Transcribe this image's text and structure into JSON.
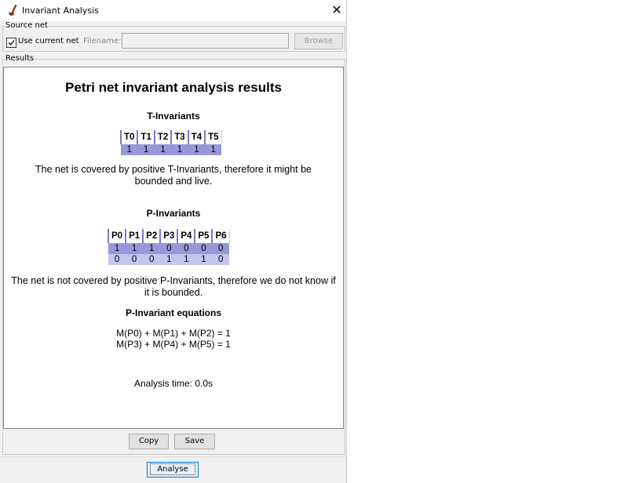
{
  "window": {
    "title": "Invariant Analysis",
    "close_glyph": "✕"
  },
  "source": {
    "legend": "Source net",
    "use_current_label": "Use current net",
    "use_current_checked": true,
    "filename_label": "Filename:",
    "filename_value": "",
    "browse_label": "Browse"
  },
  "results": {
    "legend": "Results",
    "heading": "Petri net invariant analysis results",
    "t_invariants": {
      "title": "T-Invariants",
      "headers": [
        "T0",
        "T1",
        "T2",
        "T3",
        "T4",
        "T5"
      ],
      "rows": [
        [
          "1",
          "1",
          "1",
          "1",
          "1",
          "1"
        ]
      ],
      "note": "The net is covered by positive T-Invariants, therefore it might be bounded and live."
    },
    "p_invariants": {
      "title": "P-Invariants",
      "headers": [
        "P0",
        "P1",
        "P2",
        "P3",
        "P4",
        "P5",
        "P6"
      ],
      "rows": [
        [
          "1",
          "1",
          "1",
          "0",
          "0",
          "0",
          "0"
        ],
        [
          "0",
          "0",
          "0",
          "1",
          "1",
          "1",
          "0"
        ]
      ],
      "note": "The net is not covered by positive P-Invariants, therefore we do not know if it is bounded."
    },
    "equations": {
      "title": "P-Invariant equations",
      "lines": [
        "M(P0) + M(P1) + M(P2) = 1",
        "M(P3) + M(P4) + M(P5) = 1"
      ]
    },
    "analysis_time": "Analysis time: 0.0s",
    "copy_label": "Copy",
    "save_label": "Save"
  },
  "footer": {
    "analyse_label": "Analyse"
  },
  "colors": {
    "row_dark": "#9898d8",
    "row_light": "#c4c4f0",
    "header_border": "#7a7ad0"
  },
  "icons": {
    "app": "pipe-icon",
    "close": "close-icon",
    "check": "checkmark-icon"
  }
}
